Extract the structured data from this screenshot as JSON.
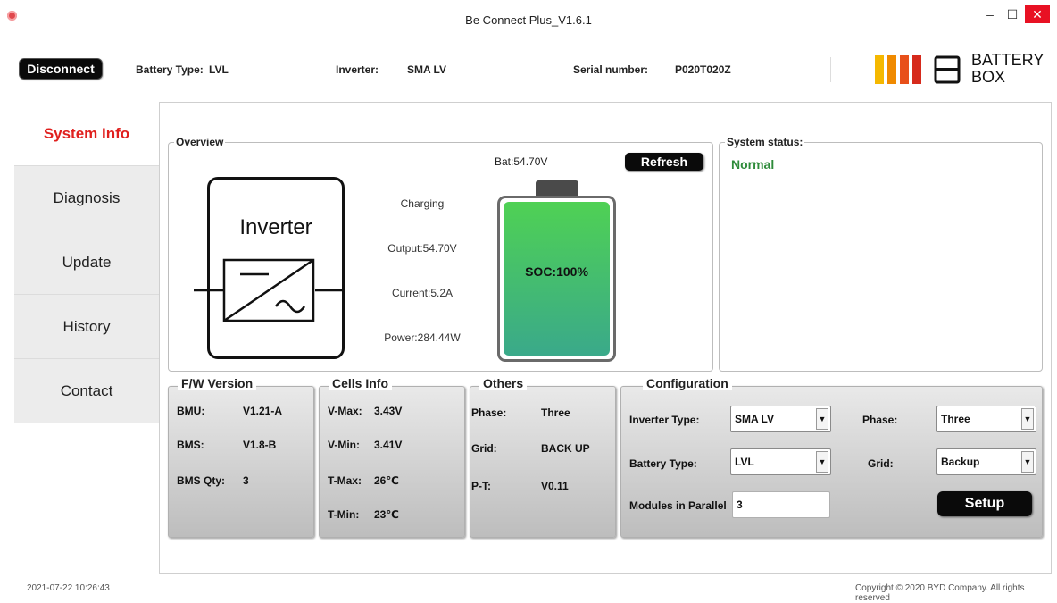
{
  "window": {
    "title": "Be Connect Plus_V1.6.1",
    "minimize": "–",
    "maximize": "☐",
    "close": "✕"
  },
  "header": {
    "disconnect_label": "Disconnect",
    "battery_type_label": "Battery Type:",
    "battery_type_value": "LVL",
    "inverter_label": "Inverter:",
    "inverter_value": "SMA LV",
    "serial_label": "Serial number:",
    "serial_value": "P020T020Z",
    "logo_line1": "BATTERY",
    "logo_line2": "BOX",
    "logo_colors": [
      "#f5b800",
      "#f08a00",
      "#e8501a",
      "#d62a1c"
    ]
  },
  "tabs": [
    {
      "label": "System Info",
      "active": true
    },
    {
      "label": "Diagnosis",
      "active": false
    },
    {
      "label": "Update",
      "active": false
    },
    {
      "label": "History",
      "active": false
    },
    {
      "label": "Contact",
      "active": false
    }
  ],
  "overview": {
    "legend": "Overview",
    "inverter_label": "Inverter",
    "state": "Charging",
    "output": "Output:54.70V",
    "current": "Current:5.2A",
    "power": "Power:284.44W",
    "bat_voltage": "Bat:54.70V",
    "refresh_label": "Refresh",
    "soc": "SOC:100%",
    "soc_fraction": 1.0
  },
  "system_status": {
    "legend": "System status:",
    "value": "Normal",
    "value_color": "#2e8b3a"
  },
  "fw_version": {
    "title": "F/W Version",
    "bmu_label": "BMU:",
    "bmu_value": "V1.21-A",
    "bms_label": "BMS:",
    "bms_value": "V1.8-B",
    "qty_label": "BMS Qty:",
    "qty_value": "3"
  },
  "cells_info": {
    "title": "Cells Info",
    "vmax_label": "V-Max:",
    "vmax_value": "3.43V",
    "vmin_label": "V-Min:",
    "vmin_value": "3.41V",
    "tmax_label": "T-Max:",
    "tmax_value": "26℃",
    "tmin_label": "T-Min:",
    "tmin_value": "23℃"
  },
  "others": {
    "title": "Others",
    "phase_label": "Phase:",
    "phase_value": "Three",
    "grid_label": "Grid:",
    "grid_value": "BACK UP",
    "pt_label": "P-T:",
    "pt_value": "V0.11"
  },
  "configuration": {
    "title": "Configuration",
    "inverter_type_label": "Inverter Type:",
    "inverter_type_value": "SMA LV",
    "battery_type_label": "Battery Type:",
    "battery_type_value": "LVL",
    "modules_label": "Modules in Parallel",
    "modules_value": "3",
    "phase_label": "Phase:",
    "phase_value": "Three",
    "grid_label": "Grid:",
    "grid_value": "Backup",
    "setup_label": "Setup"
  },
  "footer": {
    "left": "2021-07-22 10:26:43",
    "right": "Copyright © 2020 BYD Company. All rights reserved"
  }
}
